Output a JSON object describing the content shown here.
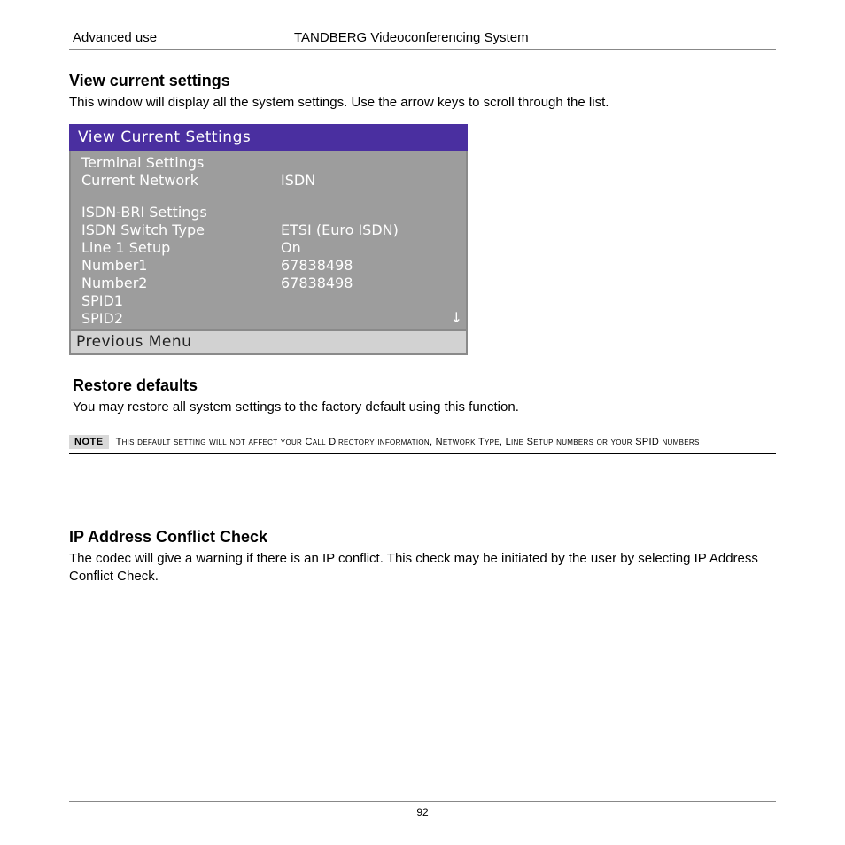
{
  "header": {
    "left": "Advanced use",
    "center": "TANDBERG Videoconferencing System"
  },
  "section_view": {
    "heading": "View current settings",
    "body": "This window will display all the system settings. Use the arrow keys to scroll through the list."
  },
  "settings_panel": {
    "title": "View Current Settings",
    "group1_heading": "Terminal Settings",
    "rows1": {
      "current_network_label": "Current Network",
      "current_network_value": "ISDN"
    },
    "group2_heading": "ISDN-BRI Settings",
    "rows2": {
      "switch_type_label": "ISDN Switch Type",
      "switch_type_value": "ETSI (Euro ISDN)",
      "line1_label": "Line 1 Setup",
      "line1_value": "On",
      "number1_label": "Number1",
      "number1_value": "67838498",
      "number2_label": "Number2",
      "number2_value": "67838498",
      "spid1_label": "SPID1",
      "spid1_value": "",
      "spid2_label": "SPID2",
      "spid2_value": ""
    },
    "scroll_indicator": "↓",
    "previous_menu": "Previous Menu"
  },
  "section_restore": {
    "heading": "Restore defaults",
    "body": "You may restore all system settings to the factory default using this function."
  },
  "note": {
    "badge": "NOTE",
    "text": "This default setting will not affect your Call Directory information, Network Type, Line Setup numbers or your SPID numbers"
  },
  "section_ip": {
    "heading": "IP Address Conflict Check",
    "body": "The codec will give a warning if there is an IP conflict. This check may be initiated by the user by selecting IP Address Conflict Check."
  },
  "footer": {
    "page_number": "92"
  }
}
